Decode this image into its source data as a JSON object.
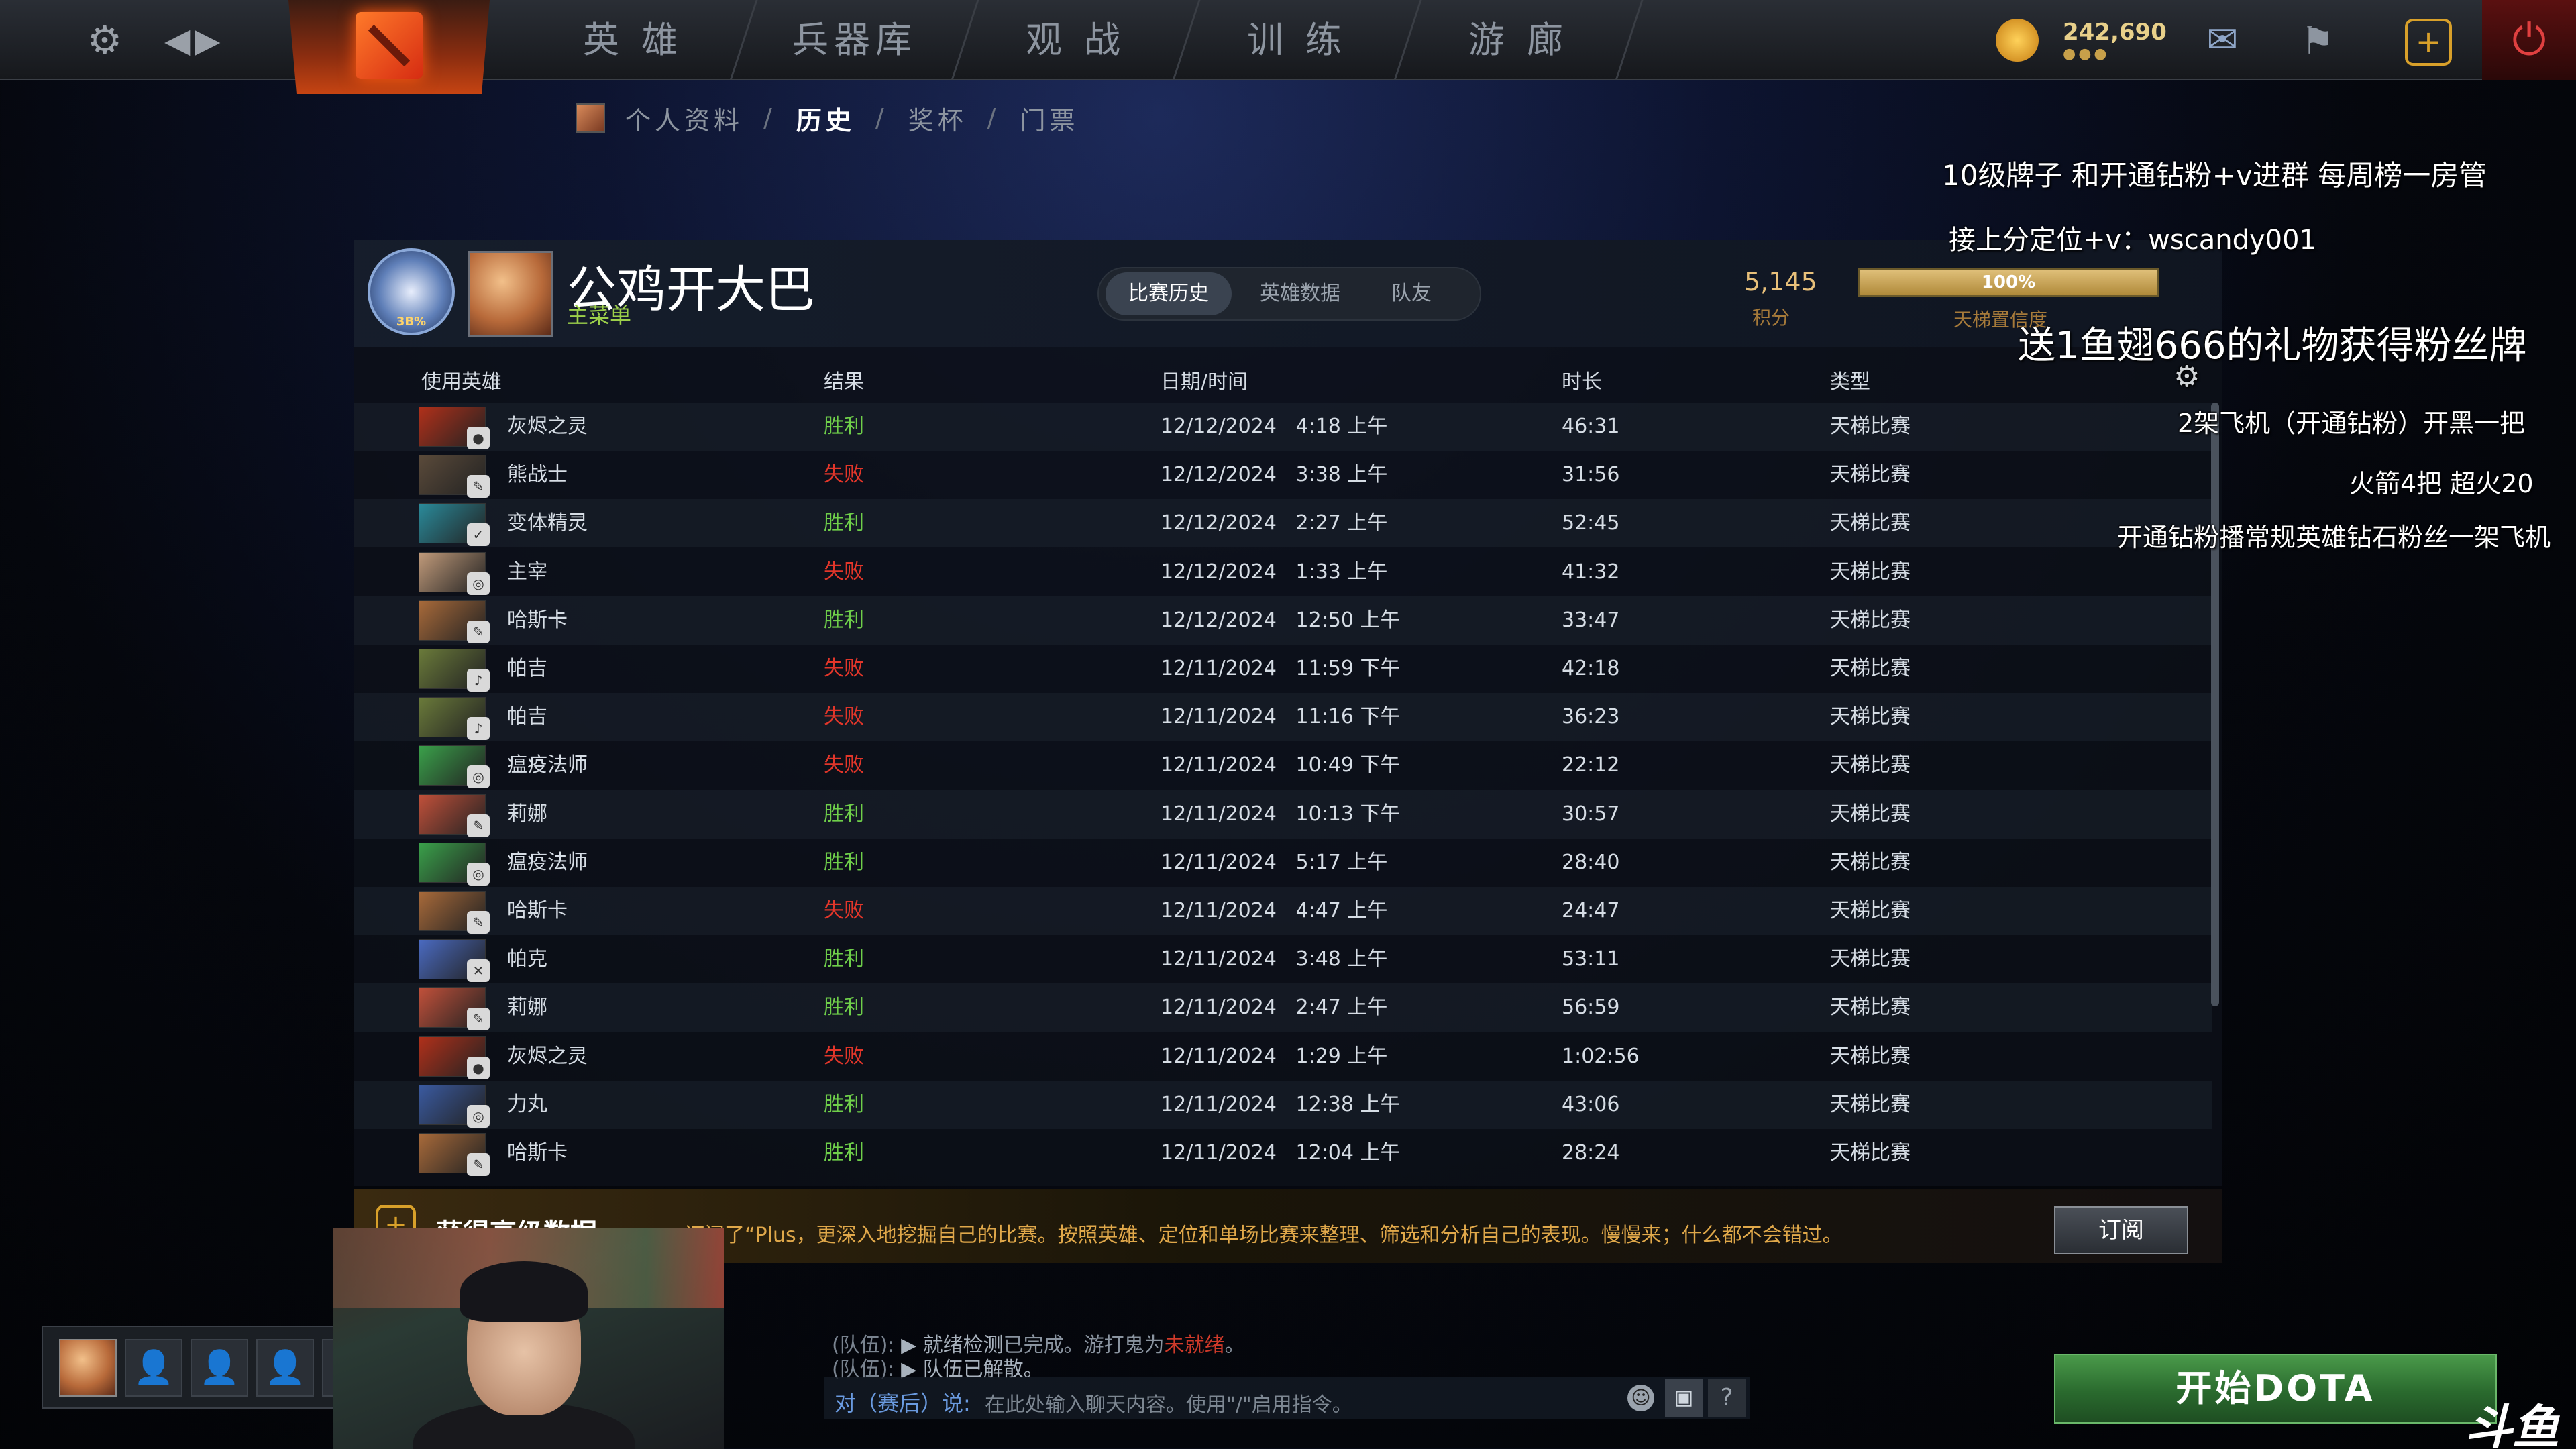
{
  "nav": {
    "tabs": [
      "英 雄",
      "兵器库",
      "观 战",
      "训 练",
      "游 廊"
    ],
    "coins": "242,690",
    "coin_dots": "●●●"
  },
  "breadcrumb": {
    "items": [
      "个人资料",
      "历史",
      "奖杯",
      "门票"
    ],
    "separator": "/",
    "active": "历史"
  },
  "profile": {
    "rank_label": "3B%",
    "player_name": "公鸡开大巴",
    "role": "主菜单",
    "tabs": [
      "比赛历史",
      "英雄数据",
      "队友"
    ],
    "active_tab": "比赛历史",
    "mmr_value": "5,145",
    "mmr_label": "积分",
    "confidence_percent": 100,
    "confidence_text": "100%",
    "confidence_label": "天梯置信度"
  },
  "table": {
    "headers": [
      "使用英雄",
      "结果",
      "日期/时间",
      "时长",
      "类型"
    ],
    "rows": [
      {
        "hero": "灰烬之灵",
        "result": "胜利",
        "win": true,
        "date": "12/12/2024   4:18 上午",
        "duration": "46:31",
        "type": "天梯比赛",
        "color": "#b0301a",
        "badge": "●"
      },
      {
        "hero": "熊战士",
        "result": "失败",
        "win": false,
        "date": "12/12/2024   3:38 上午",
        "duration": "31:56",
        "type": "天梯比赛",
        "color": "#5a4a3a",
        "badge": "✎"
      },
      {
        "hero": "变体精灵",
        "result": "胜利",
        "win": true,
        "date": "12/12/2024   2:27 上午",
        "duration": "52:45",
        "type": "天梯比赛",
        "color": "#2a8a9a",
        "badge": "✓"
      },
      {
        "hero": "主宰",
        "result": "失败",
        "win": false,
        "date": "12/12/2024   1:33 上午",
        "duration": "41:32",
        "type": "天梯比赛",
        "color": "#c09a7a",
        "badge": "◎"
      },
      {
        "hero": "哈斯卡",
        "result": "胜利",
        "win": true,
        "date": "12/12/2024   12:50 上午",
        "duration": "33:47",
        "type": "天梯比赛",
        "color": "#a86a3a",
        "badge": "✎"
      },
      {
        "hero": "帕吉",
        "result": "失败",
        "win": false,
        "date": "12/11/2024   11:59 下午",
        "duration": "42:18",
        "type": "天梯比赛",
        "color": "#6a7a3a",
        "badge": "♪"
      },
      {
        "hero": "帕吉",
        "result": "失败",
        "win": false,
        "date": "12/11/2024   11:16 下午",
        "duration": "36:23",
        "type": "天梯比赛",
        "color": "#6a7a3a",
        "badge": "♪"
      },
      {
        "hero": "瘟疫法师",
        "result": "失败",
        "win": false,
        "date": "12/11/2024   10:49 下午",
        "duration": "22:12",
        "type": "天梯比赛",
        "color": "#3aa04a",
        "badge": "◎"
      },
      {
        "hero": "莉娜",
        "result": "胜利",
        "win": true,
        "date": "12/11/2024   10:13 下午",
        "duration": "30:57",
        "type": "天梯比赛",
        "color": "#c0503a",
        "badge": "✎"
      },
      {
        "hero": "瘟疫法师",
        "result": "胜利",
        "win": true,
        "date": "12/11/2024   5:17 上午",
        "duration": "28:40",
        "type": "天梯比赛",
        "color": "#3aa04a",
        "badge": "◎"
      },
      {
        "hero": "哈斯卡",
        "result": "失败",
        "win": false,
        "date": "12/11/2024   4:47 上午",
        "duration": "24:47",
        "type": "天梯比赛",
        "color": "#a86a3a",
        "badge": "✎"
      },
      {
        "hero": "帕克",
        "result": "胜利",
        "win": true,
        "date": "12/11/2024   3:48 上午",
        "duration": "53:11",
        "type": "天梯比赛",
        "color": "#4a6ac0",
        "badge": "✕"
      },
      {
        "hero": "莉娜",
        "result": "胜利",
        "win": true,
        "date": "12/11/2024   2:47 上午",
        "duration": "56:59",
        "type": "天梯比赛",
        "color": "#c0503a",
        "badge": "✎"
      },
      {
        "hero": "灰烬之灵",
        "result": "失败",
        "win": false,
        "date": "12/11/2024   1:29 上午",
        "duration": "1:02:56",
        "type": "天梯比赛",
        "color": "#b0301a",
        "badge": "●"
      },
      {
        "hero": "力丸",
        "result": "胜利",
        "win": true,
        "date": "12/11/2024   12:38 上午",
        "duration": "43:06",
        "type": "天梯比赛",
        "color": "#3a5aa0",
        "badge": "◎"
      },
      {
        "hero": "哈斯卡",
        "result": "胜利",
        "win": true,
        "date": "12/11/2024   12:04 上午",
        "duration": "28:24",
        "type": "天梯比赛",
        "color": "#a86a3a",
        "badge": "✎"
      }
    ]
  },
  "plus_banner": {
    "title": "获得高级数据",
    "text": "订阅了“Plus，更深入地挖掘自己的比赛。按照英雄、定位和单场比赛来整理、筛选和分析自己的表现。慢慢来；什么都不会错过。",
    "button": "订阅"
  },
  "chat": {
    "lines": [
      {
        "who": "(队伍):",
        "msg": "▶ 就绪检测",
        "msg2": "已完成。游打鬼为",
        "red": "未就绪",
        "end": "。"
      },
      {
        "who": "(队伍):",
        "msg": "▶ 队伍已解散。",
        "msg2": "",
        "red": "",
        "end": ""
      }
    ],
    "input_prefix": "对（赛后）说:",
    "input_placeholder": "在此处输入聊天内容。使用\"/\"启用指令。"
  },
  "start_button": "开始DOTA",
  "watermark": "斗鱼",
  "overlay": {
    "line1": "10级牌子 和开通钻粉+v进群  每周榜一房管",
    "line2": "接上分定位+v：wscandy001",
    "line3": "送1鱼翅666的礼物获得粉丝牌",
    "line4": "2架飞机（开通钻粉）开黑一把",
    "line5": "火箭4把 超火20",
    "line6": "开通钻粉播常规英雄钻石粉丝一架飞机"
  }
}
